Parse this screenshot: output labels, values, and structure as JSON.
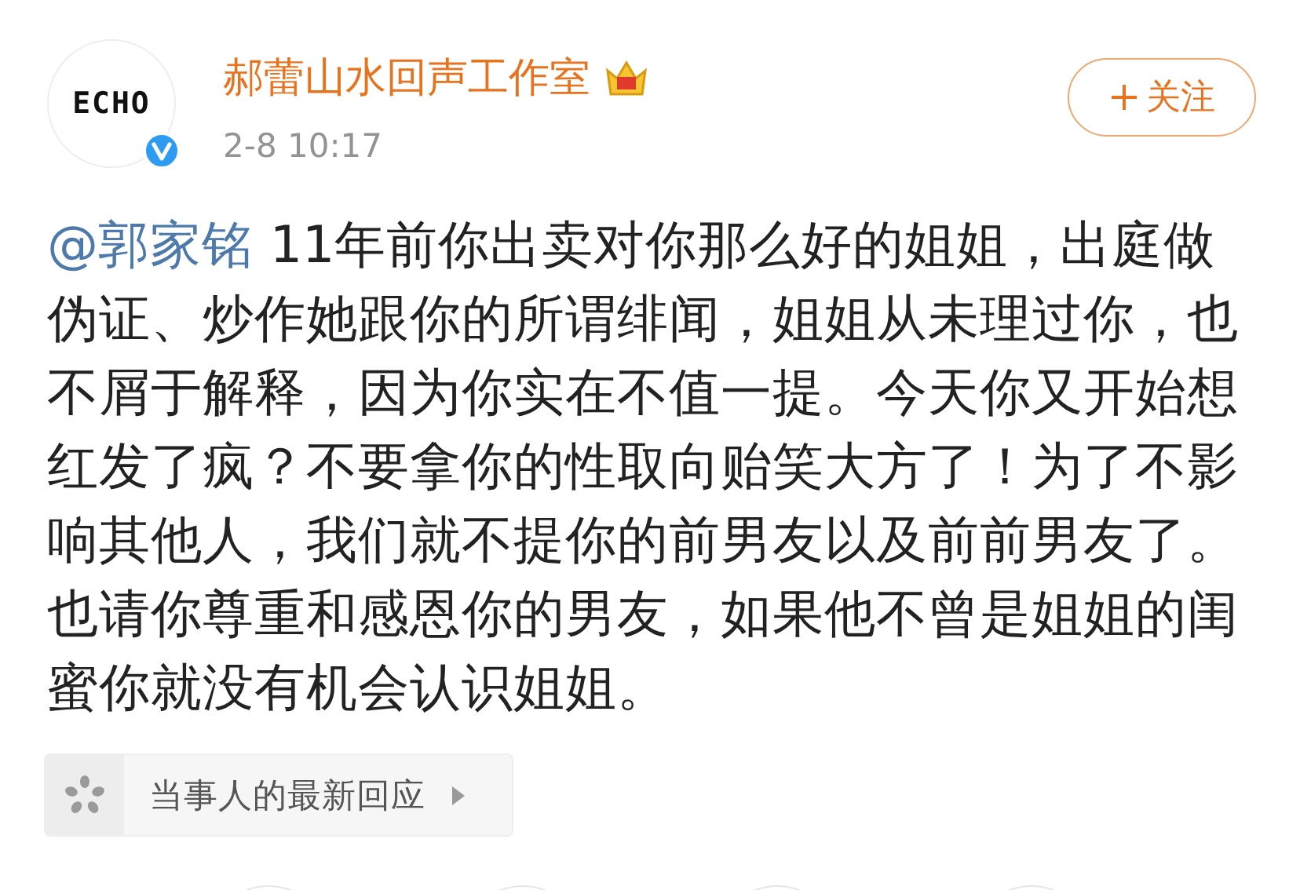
{
  "author": {
    "name": "郝蕾山水回声工作室",
    "time": "2-8 10:17",
    "avatar_logo": "ECHO",
    "verified": true
  },
  "follow_button": {
    "label": "关注"
  },
  "post": {
    "mention": "@郭家铭",
    "text": " 11年前你出卖对你那么好的姐姐，出庭做伪证、炒作她跟你的所谓绯闻，姐姐从未理过你，也不屑于解释，因为你实在不值一提。今天你又开始想红发了疯？不要拿你的性取向贻笑大方了！为了不影响其他人，我们就不提你的前男友以及前前男友了。也请你尊重和感恩你的男友，如果他不曾是姐姐的闺蜜你就没有机会认识姐姐。"
  },
  "topic_card": {
    "label": "当事人的最新回应"
  }
}
